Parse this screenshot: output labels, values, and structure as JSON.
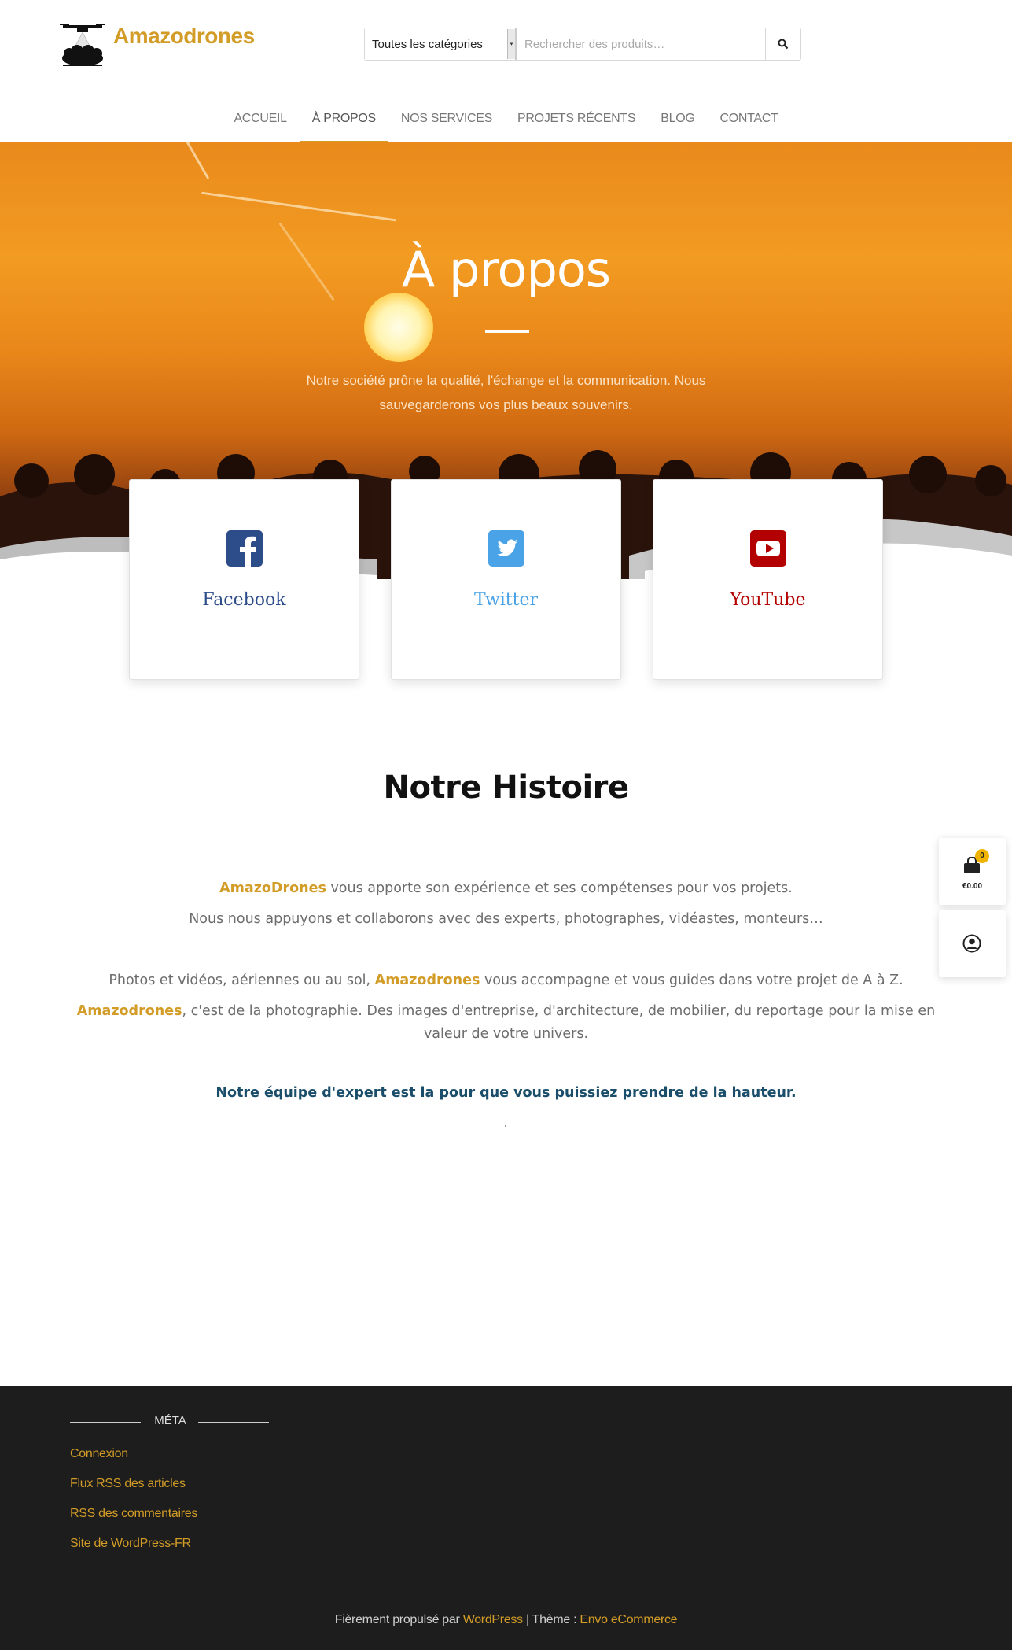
{
  "site": {
    "title": "Amazodrones"
  },
  "search": {
    "category": "Toutes les catégories",
    "placeholder": "Rechercher des produits…"
  },
  "nav": {
    "items": [
      "ACCUEIL",
      "À PROPOS",
      "NOS SERVICES",
      "PROJETS RÉCENTS",
      "BLOG",
      "CONTACT"
    ],
    "active_index": 1
  },
  "hero": {
    "title": "À propos",
    "text_line1": "Notre société prône la qualité, l'échange et la communication. Nous",
    "text_line2": "sauvegarderons vos plus beaux souvenirs."
  },
  "social": [
    {
      "label": "Facebook",
      "icon": "facebook-icon",
      "color": "#2d4c8a"
    },
    {
      "label": "Twitter",
      "icon": "twitter-icon",
      "color": "#4aa3e6"
    },
    {
      "label": "YouTube",
      "icon": "youtube-icon",
      "color": "#b30000"
    }
  ],
  "history": {
    "title": "Notre Histoire",
    "p1_brand": "AmazoDrones",
    "p1_rest": " vous apporte son expérience et ses compétenses pour vos projets.",
    "p2": "Nous nous appuyons et collaborons avec des experts, photographes, vidéastes, monteurs…",
    "p3_start": "Photos et vidéos, aériennes ou au sol,  ",
    "p3_brand": "Amazodrones",
    "p3_end": " vous accompagne et vous guides dans votre projet de A à Z.",
    "p4_brand": "Amazodrones",
    "p4_rest": ", c'est de la photographie. Des images d'entreprise, d'architecture, de mobilier, du reportage pour la mise en",
    "p4_line2": "valeur de votre univers.",
    "team": "Notre équipe d'expert est la pour que vous puissiez prendre de la hauteur."
  },
  "cart": {
    "count": "0",
    "total": "€0.00"
  },
  "footer": {
    "meta_title": "MÉTA",
    "meta_links": [
      "Connexion",
      "Flux RSS des articles",
      "RSS des commentaires",
      "Site de WordPress-FR"
    ],
    "credits_prefix": "Fièrement propulsé par ",
    "credits_wp": "WordPress",
    "credits_sep": " | Thème : ",
    "credits_theme": "Envo eCommerce"
  },
  "colors": {
    "accent": "#d29c27",
    "footer_bg": "#1d1d1d",
    "team_text": "#1b4e6a"
  }
}
